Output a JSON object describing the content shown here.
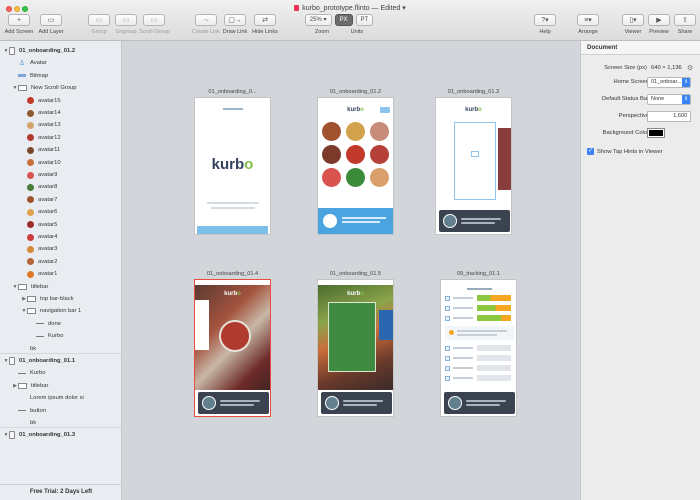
{
  "window": {
    "title": "kurbo_prototype.flinto — Edited ▾"
  },
  "toolbar": {
    "add_screen": "Add Screen",
    "add_layer": "Add Layer",
    "group": "Group",
    "ungroup": "Ungroup",
    "scroll_group": "Scroll Group",
    "create_link": "Create Link",
    "draw_link": "Draw Link",
    "hide_links": "Hide Links",
    "zoom_value": "25%",
    "zoom_label": "Zoom",
    "units_label": "Units",
    "unit_px": "PX",
    "unit_pt": "PT",
    "help": "Help",
    "arrange": "Arrange",
    "viewer": "Viewer",
    "preview": "Preview",
    "share": "Share"
  },
  "sidebar": {
    "layers": [
      {
        "label": "01_onboarding_01.2",
        "type": "artboard",
        "indent": 0,
        "tri": "▼"
      },
      {
        "label": "Avatar",
        "type": "person",
        "indent": 1,
        "tri": ""
      },
      {
        "label": "Bitmap",
        "type": "bitmap",
        "indent": 1,
        "tri": ""
      },
      {
        "label": "New Scroll Group",
        "type": "group",
        "indent": 1,
        "tri": "▼"
      },
      {
        "label": "avatar15",
        "type": "avatar",
        "indent": 2,
        "color": "#c0392b"
      },
      {
        "label": "avatar14",
        "type": "avatar",
        "indent": 2,
        "color": "#8e5a2b"
      },
      {
        "label": "avatar13",
        "type": "avatar",
        "indent": 2,
        "color": "#d3a36b"
      },
      {
        "label": "avatar12",
        "type": "avatar",
        "indent": 2,
        "color": "#b03a2e"
      },
      {
        "label": "avatar11",
        "type": "avatar",
        "indent": 2,
        "color": "#7a4a2a"
      },
      {
        "label": "avatar10",
        "type": "avatar",
        "indent": 2,
        "color": "#c96f3b"
      },
      {
        "label": "avatar9",
        "type": "avatar",
        "indent": 2,
        "color": "#d9534f"
      },
      {
        "label": "avatar8",
        "type": "avatar",
        "indent": 2,
        "color": "#4a7b3b"
      },
      {
        "label": "avatar7",
        "type": "avatar",
        "indent": 2,
        "color": "#a0522d"
      },
      {
        "label": "avatar6",
        "type": "avatar",
        "indent": 2,
        "color": "#e0a050"
      },
      {
        "label": "avatar5",
        "type": "avatar",
        "indent": 2,
        "color": "#9b2d2d"
      },
      {
        "label": "avatar4",
        "type": "avatar",
        "indent": 2,
        "color": "#cf3a3a"
      },
      {
        "label": "avatar3",
        "type": "avatar",
        "indent": 2,
        "color": "#d48a3a"
      },
      {
        "label": "avatar2",
        "type": "avatar",
        "indent": 2,
        "color": "#b5653a"
      },
      {
        "label": "avatar1",
        "type": "avatar",
        "indent": 2,
        "color": "#e07a2a"
      },
      {
        "label": "titlebar",
        "type": "group",
        "indent": 1,
        "tri": "▼"
      },
      {
        "label": "top bar-black",
        "type": "group",
        "indent": 2,
        "tri": "▶"
      },
      {
        "label": "navigation bar 1",
        "type": "group",
        "indent": 2,
        "tri": "▼"
      },
      {
        "label": "done",
        "type": "line",
        "indent": 3
      },
      {
        "label": "Kurbo",
        "type": "line",
        "indent": 3
      },
      {
        "label": "bk",
        "type": "text",
        "indent": 1
      },
      {
        "label": "01_onboarding_01.1",
        "type": "artboard",
        "indent": 0,
        "tri": "▼"
      },
      {
        "label": "Kurbo",
        "type": "line",
        "indent": 1
      },
      {
        "label": "titlebar",
        "type": "group",
        "indent": 1,
        "tri": "▶"
      },
      {
        "label": "Lorem ipsum dolor si",
        "type": "text",
        "indent": 1
      },
      {
        "label": "button",
        "type": "line",
        "indent": 1
      },
      {
        "label": "bk",
        "type": "text",
        "indent": 1
      },
      {
        "label": "01_onboarding_01.3",
        "type": "artboard",
        "indent": 0,
        "tri": "▼"
      }
    ],
    "trial": "Free Trial: 2 Days Left"
  },
  "canvas": {
    "artboards": [
      {
        "title": "01_onboarding_0...",
        "kind": "splash"
      },
      {
        "title": "01_onboarding_01.2",
        "kind": "avatars"
      },
      {
        "title": "01_onboarding_01.3",
        "kind": "add-photo"
      },
      {
        "title": "01_onboarding_01.4",
        "kind": "photo-a"
      },
      {
        "title": "01_onboarding_01.5",
        "kind": "photo-b"
      },
      {
        "title": "09_tracking_01.1",
        "kind": "tracking"
      }
    ],
    "brand_word": "kurbo"
  },
  "inspector": {
    "title": "Document",
    "screen_size_label": "Screen Size (px)",
    "screen_size_value": "640 × 1,136",
    "home_screen_label": "Home Screen",
    "home_screen_value": "01_onboar...",
    "status_bar_label": "Default Status Bar",
    "status_bar_value": "None",
    "perspective_label": "Perspective",
    "perspective_value": "1,600",
    "bg_color_label": "Background Color",
    "bg_color": "#000000",
    "tap_hints_label": "Show Tap Hints in Viewer"
  },
  "colors": {
    "accent": "#3b82f6",
    "canvas_bg": "#d2d5da",
    "kurbo_navy": "#33425c",
    "kurbo_green": "#7fc04a",
    "tracking_green": "#8dc63f",
    "tracking_orange": "#f5a623"
  }
}
